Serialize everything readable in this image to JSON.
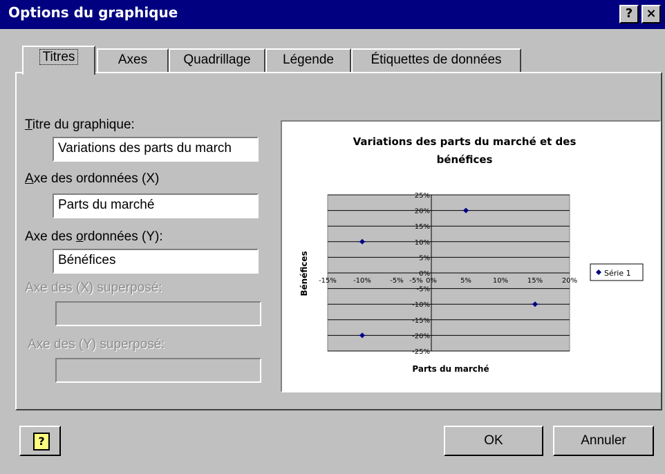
{
  "window": {
    "title": "Options du graphique",
    "help_glyph": "?",
    "close_glyph": "×"
  },
  "tabs": [
    {
      "label": "Titres",
      "active": true
    },
    {
      "label": "Axes"
    },
    {
      "label": "Quadrillage"
    },
    {
      "label": "Légende"
    },
    {
      "label": "Étiquettes de données"
    }
  ],
  "form": {
    "chart_title": {
      "label_accel": "T",
      "label_rest": "itre du graphique:",
      "value": "Variations des parts du march"
    },
    "x_axis": {
      "label_accel": "A",
      "label_rest": "xe des ordonnées (X)",
      "value": "Parts du marché"
    },
    "y_axis": {
      "label_pre": "Axe des ",
      "label_accel": "o",
      "label_rest": "rdonnées (Y):",
      "value": "Bénéfices"
    },
    "x_secondary": {
      "label": "Axe des (X)  superposé:",
      "value": ""
    },
    "y_secondary": {
      "label": "Axe des (Y) superposé:",
      "value": ""
    }
  },
  "footer": {
    "help_icon": "question-icon",
    "help_glyph": "?",
    "ok": "OK",
    "cancel": "Annuler"
  },
  "colors": {
    "titlebar": "#000080",
    "face": "#c0c0c0",
    "plot_bg": "#c0c0c0",
    "marker": "#000080"
  },
  "chart_data": {
    "type": "scatter",
    "title": "Variations des parts du marché et des bénéfices",
    "xlabel": "Parts du marché",
    "ylabel": "Bénéfices",
    "xlim": [
      -15,
      20
    ],
    "ylim": [
      -25,
      25
    ],
    "x_ticks": [
      "-15%",
      "-10%",
      "-5%",
      "-5%",
      "0%",
      "5%",
      "10%",
      "15%",
      "20%"
    ],
    "y_ticks": [
      "25%",
      "20%",
      "15%",
      "10%",
      "5%",
      "0%",
      "-5%",
      "-10%",
      "-15%",
      "-20%",
      "-25%"
    ],
    "grid": true,
    "legend_position": "right",
    "series": [
      {
        "name": "Série 1",
        "points": [
          [
            -10,
            10
          ],
          [
            -10,
            -20
          ],
          [
            5,
            20
          ],
          [
            15,
            -10
          ]
        ]
      }
    ]
  }
}
